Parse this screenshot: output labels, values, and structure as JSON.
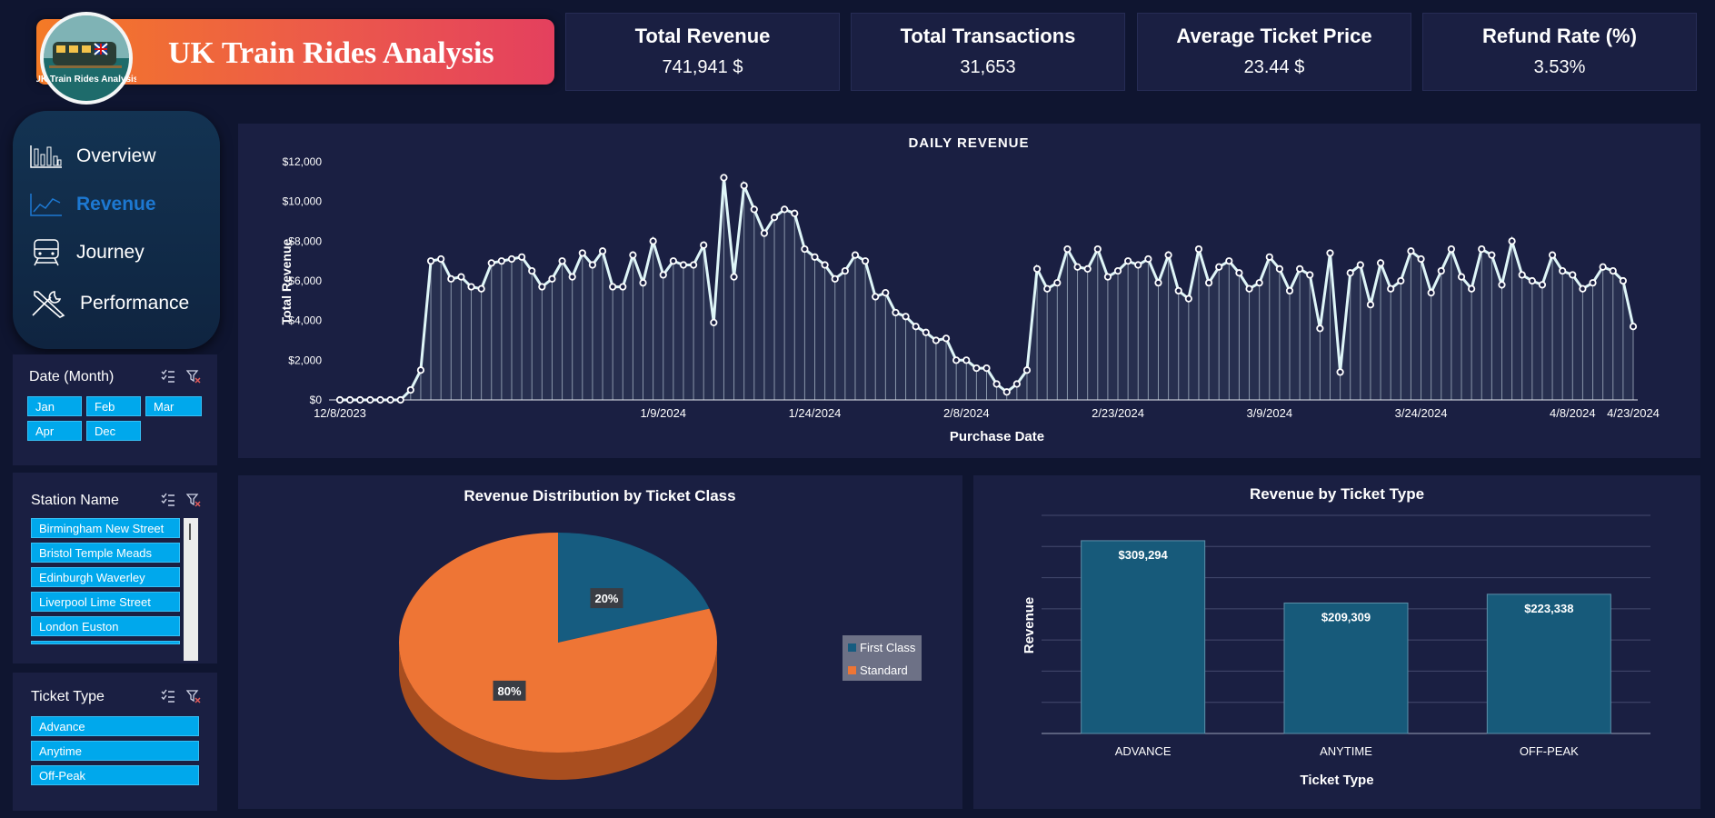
{
  "header": {
    "title": "UK Train Rides Analysis",
    "logo_text": "UK Train Rides Analysis"
  },
  "kpis": [
    {
      "label": "Total Revenue",
      "value": "741,941 $"
    },
    {
      "label": "Total Transactions",
      "value": "31,653"
    },
    {
      "label": "Average Ticket Price",
      "value": "23.44 $"
    },
    {
      "label": "Refund Rate (%)",
      "value": "3.53%"
    }
  ],
  "nav": {
    "items": [
      {
        "label": "Overview",
        "icon": "bar-chart-icon",
        "active": false
      },
      {
        "label": "Revenue",
        "icon": "line-chart-icon",
        "active": true
      },
      {
        "label": "Journey",
        "icon": "train-icon",
        "active": false
      },
      {
        "label": "Performance",
        "icon": "tools-icon",
        "active": false
      }
    ]
  },
  "slicers": {
    "month": {
      "title": "Date (Month)",
      "items": [
        "Jan",
        "Feb",
        "Mar",
        "Apr",
        "Dec"
      ]
    },
    "station": {
      "title": "Station Name",
      "items": [
        "Birmingham New Street",
        "Bristol Temple Meads",
        "Edinburgh Waverley",
        "Liverpool Lime Street",
        "London Euston"
      ]
    },
    "ticket_type": {
      "title": "Ticket Type",
      "items": [
        "Advance",
        "Anytime",
        "Off-Peak"
      ]
    }
  },
  "colors": {
    "background": "#0f1530",
    "panel": "#1a1f42",
    "chip": "#00a8ec",
    "first_class": "#165c80",
    "standard": "#ee7535",
    "line": "#c8f0f5",
    "accent_active": "#1d78d1"
  },
  "chart_data": [
    {
      "type": "line",
      "title": "DAILY REVENUE",
      "xlabel": "Purchase Date",
      "ylabel": "Total Revenue",
      "ylim": [
        0,
        12000
      ],
      "yticks": [
        "$0",
        "$2,000",
        "$4,000",
        "$6,000",
        "$8,000",
        "$10,000",
        "$12,000"
      ],
      "xticks": [
        "12/8/2023",
        "1/9/2024",
        "1/24/2024",
        "2/8/2024",
        "2/23/2024",
        "3/9/2024",
        "3/24/2024",
        "4/8/2024",
        "4/23/2024"
      ],
      "x_start": "2023-12-08",
      "grid": false,
      "series": [
        {
          "values": [
            0,
            0,
            0,
            0,
            0,
            0,
            0,
            500,
            1500,
            7000,
            7100,
            6100,
            6200,
            5700,
            5600,
            6900,
            7000,
            7100,
            7200,
            6500,
            5700,
            6100,
            7000,
            6200,
            7400,
            6800,
            7500,
            5700,
            5700,
            7300,
            5900,
            8000,
            6300,
            7000,
            6800,
            6800,
            7800,
            3900,
            11200,
            6200,
            10800,
            9600,
            8400,
            9200,
            9600,
            9400,
            7600,
            7200,
            6800,
            6100,
            6500,
            7300,
            7000,
            5200,
            5400,
            4400,
            4200,
            3700,
            3400,
            3000,
            3100,
            2000,
            2000,
            1600,
            1600,
            800,
            400,
            800,
            1500,
            6600,
            5600,
            5900,
            7600,
            6700,
            6600,
            7600,
            6200,
            6500,
            7000,
            6800,
            7100,
            5900,
            7300,
            5500,
            5100,
            7600,
            5900,
            6700,
            7000,
            6400,
            5600,
            5900,
            7200,
            6600,
            5500,
            6600,
            6300,
            3600,
            7400,
            1400,
            6400,
            6800,
            4800,
            6900,
            5600,
            6000,
            7500,
            7100,
            5400,
            6500,
            7600,
            6200,
            5600,
            7600,
            7300,
            5800,
            8000,
            6300,
            6000,
            5800,
            7300,
            6500,
            6300,
            5600,
            5900,
            6700,
            6500,
            6000,
            3700
          ]
        }
      ]
    },
    {
      "type": "pie",
      "title": "Revenue Distribution by Ticket Class",
      "categories": [
        "First Class",
        "Standard"
      ],
      "values": [
        20,
        80
      ],
      "labels": [
        "20%",
        "80%"
      ],
      "legend": "right"
    },
    {
      "type": "bar",
      "title": "Revenue by Ticket Type",
      "xlabel": "Ticket Type",
      "ylabel": "Revenue",
      "categories": [
        "ADVANCE",
        "ANYTIME",
        "OFF-PEAK"
      ],
      "values": [
        309294,
        209309,
        223338
      ],
      "labels": [
        "$309,294",
        "$209,309",
        "$223,338"
      ],
      "ylim": [
        0,
        350000
      ],
      "grid": true
    }
  ]
}
